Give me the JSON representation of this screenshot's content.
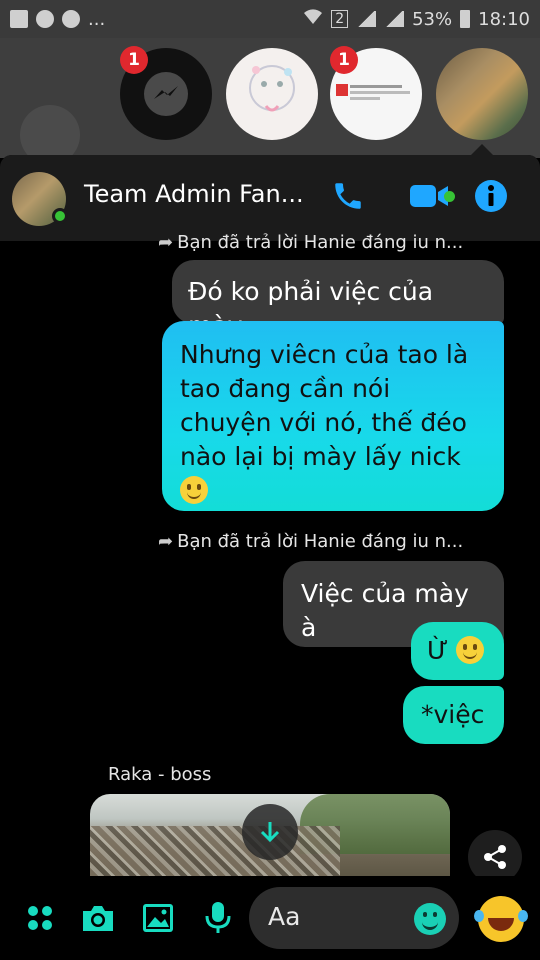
{
  "status_bar": {
    "ellipsis": "...",
    "sim": "2",
    "battery": "53%",
    "time": "18:10"
  },
  "chat_heads": [
    {
      "name": "messenger",
      "badge": "1"
    },
    {
      "name": "doodle"
    },
    {
      "name": "post",
      "badge": "1"
    },
    {
      "name": "cats"
    }
  ],
  "header": {
    "title": "Team Admin Fan...",
    "accent_color": "#1fa7ff"
  },
  "messages": [
    {
      "type": "reply_note",
      "text": "Bạn đã trả lời Hanie đáng iu n..."
    },
    {
      "type": "bubble",
      "style": "gray",
      "text": "Đó ko phải việc của mày"
    },
    {
      "type": "bubble",
      "style": "cyan",
      "text": "Nhưng viêcn của tao là tao đang cần nói chuyện với nó, thế đéo nào lại bị mày lấy nick",
      "emoji": "smile"
    },
    {
      "type": "reply_note",
      "text": "Bạn đã trả lời Hanie đáng iu n..."
    },
    {
      "type": "bubble",
      "style": "gray",
      "text": "Việc của mày à"
    },
    {
      "type": "bubble",
      "style": "teal",
      "text": "Ừ",
      "emoji": "smile"
    },
    {
      "type": "bubble",
      "style": "teal",
      "text": "*việc"
    }
  ],
  "sender_label": "Raka - boss",
  "composer": {
    "placeholder": "Aa",
    "accent_color": "#18dcc0"
  },
  "colors": {
    "teal": "#18dcc0",
    "cyan": "#20bef2",
    "online": "#37c336",
    "badge": "#e0282e"
  }
}
